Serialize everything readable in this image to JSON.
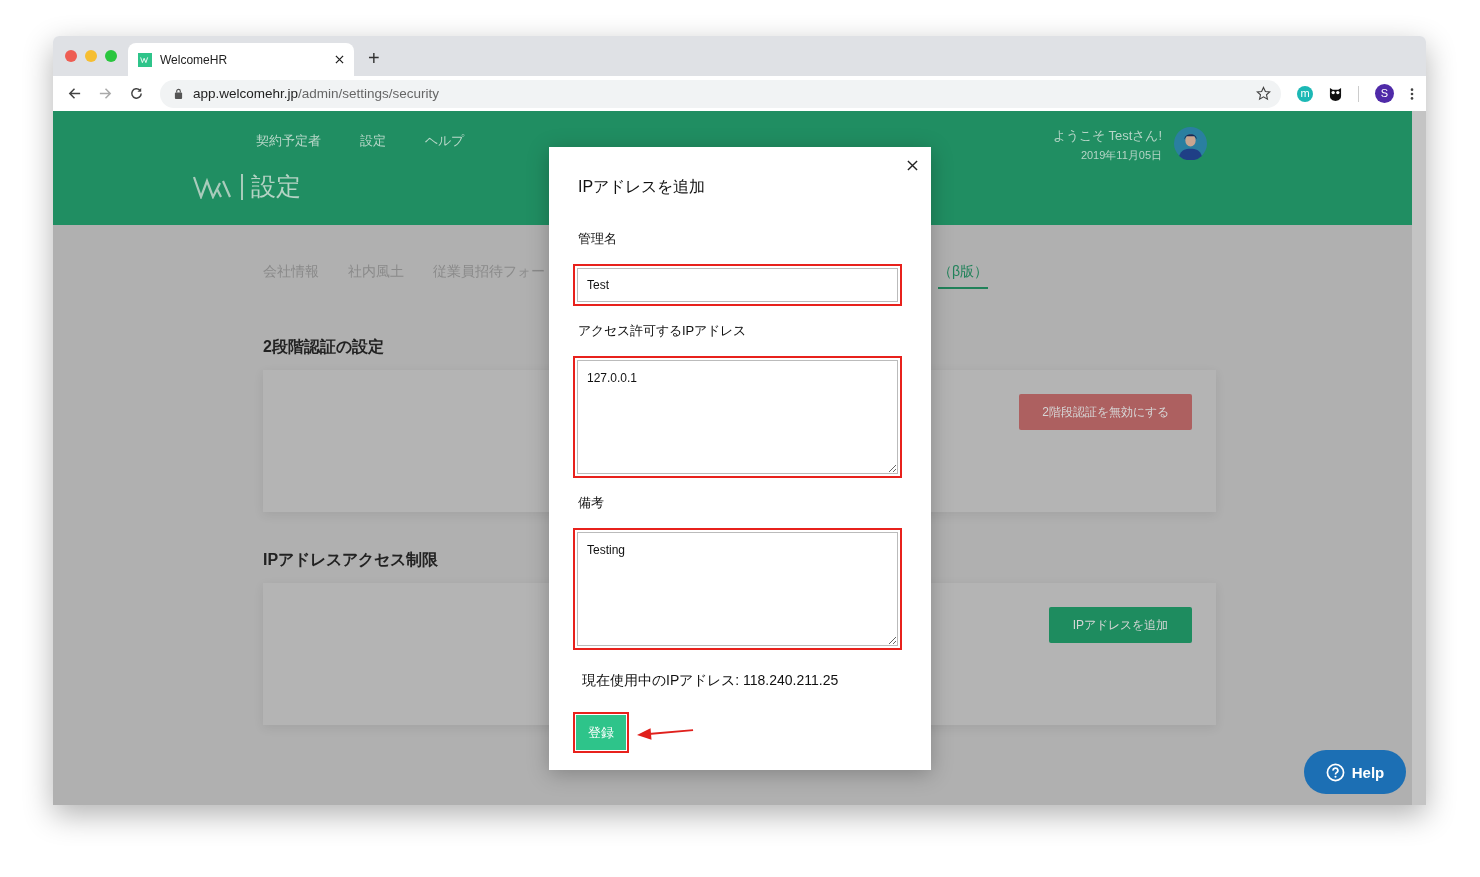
{
  "browser": {
    "tab_title": "WelcomeHR",
    "url_host": "app.welcomehr.jp",
    "url_path": "/admin/settings/security",
    "new_tab": "+",
    "extension_letter": "m",
    "profile_letter": "S"
  },
  "header": {
    "nav": [
      "契約予定者",
      "設定",
      "ヘルプ"
    ],
    "page_title": "設定",
    "welcome": "ようこそ Testさん!",
    "date": "2019年11月05日"
  },
  "tabs": [
    {
      "label": "会社情報",
      "selected": false
    },
    {
      "label": "社内風土",
      "selected": false
    },
    {
      "label": "従業員招待フォー",
      "selected": false
    },
    {
      "label": "（β版）",
      "selected": true
    }
  ],
  "sections": [
    {
      "title": "2段階認証の設定",
      "button": "2階段認証を無効にする",
      "kind": "danger"
    },
    {
      "title": "IPアドレスアクセス制限",
      "button": "IPアドレスを追加",
      "kind": "primary"
    }
  ],
  "modal": {
    "title": "IPアドレスを追加",
    "fields": [
      {
        "label": "管理名",
        "value": "Test",
        "kind": "input"
      },
      {
        "label": "アクセス許可するIPアドレス",
        "value": "127.0.0.1",
        "kind": "textarea"
      },
      {
        "label": "備考",
        "value": "Testing",
        "kind": "textarea"
      }
    ],
    "current_ip": "現在使用中のIPアドレス: 118.240.211.25",
    "submit": "登録"
  },
  "help": "Help"
}
